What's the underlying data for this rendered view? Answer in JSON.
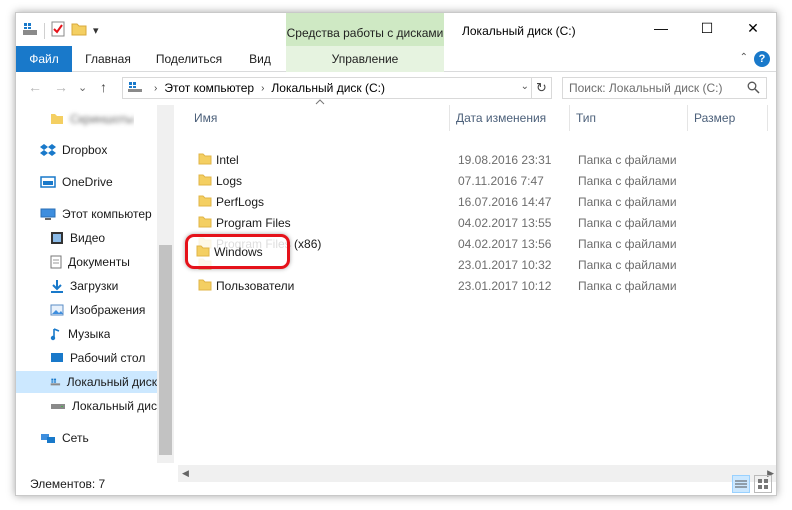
{
  "window": {
    "title": "Локальный диск (C:)",
    "controls": {
      "minimize": "—",
      "maximize": "☐",
      "close": "✕"
    }
  },
  "quick_access_toolbar": {
    "dropdown": "▾"
  },
  "context_tab_header": "Средства работы с дисками",
  "ribbon": {
    "tabs": [
      "Файл",
      "Главная",
      "Поделиться",
      "Вид",
      "Управление"
    ],
    "help": "?",
    "collapse": "⌃"
  },
  "navigation": {
    "back": "←",
    "forward": "→",
    "recent": "⌄",
    "up": "↑"
  },
  "address": {
    "crumbs": [
      "Этот компьютер",
      "Локальный диск (C:)"
    ],
    "refresh": "↻",
    "separator": "›",
    "dropdown": "⌄"
  },
  "search": {
    "placeholder": "Поиск: Локальный диск (C:)"
  },
  "nav_pane": {
    "items": [
      {
        "label": "Скриншоты",
        "icon": "pin-folder-icon"
      },
      {
        "label": "Dropbox",
        "icon": "dropbox-icon"
      },
      {
        "label": "OneDrive",
        "icon": "onedrive-icon"
      },
      {
        "label": "Этот компьютер",
        "icon": "computer-icon"
      },
      {
        "label": "Видео",
        "icon": "video-icon"
      },
      {
        "label": "Документы",
        "icon": "documents-icon"
      },
      {
        "label": "Загрузки",
        "icon": "downloads-icon"
      },
      {
        "label": "Изображения",
        "icon": "pictures-icon"
      },
      {
        "label": "Музыка",
        "icon": "music-icon"
      },
      {
        "label": "Рабочий стол",
        "icon": "desktop-icon"
      },
      {
        "label": "Локальный диск",
        "icon": "windows-drive-icon"
      },
      {
        "label": "Локальный диск",
        "icon": "drive-icon"
      },
      {
        "label": "Сеть",
        "icon": "network-icon"
      }
    ]
  },
  "columns": [
    "Имя",
    "Дата изменения",
    "Тип",
    "Размер"
  ],
  "files": [
    {
      "name": "Intel",
      "date": "19.08.2016 23:31",
      "type": "Папка с файлами"
    },
    {
      "name": "Logs",
      "date": "07.11.2016 7:47",
      "type": "Папка с файлами"
    },
    {
      "name": "PerfLogs",
      "date": "16.07.2016 14:47",
      "type": "Папка с файлами"
    },
    {
      "name": "Program Files",
      "date": "04.02.2017 13:55",
      "type": "Папка с файлами"
    },
    {
      "name": "Program Files (x86)",
      "date": "04.02.2017 13:56",
      "type": "Папка с файлами"
    },
    {
      "name": "Windows",
      "date": "23.01.2017 10:32",
      "type": "Папка с файлами"
    },
    {
      "name": "Пользователи",
      "date": "23.01.2017 10:12",
      "type": "Папка с файлами"
    }
  ],
  "scroll": {
    "left": "◀",
    "right": "▶"
  },
  "status": {
    "count": "Элементов: 7"
  },
  "colors": {
    "accent": "#1979ca",
    "context_tab": "#cfe9c4",
    "highlight": "#e5121a",
    "selected": "#cce8ff",
    "folder": "#f4cf62"
  }
}
